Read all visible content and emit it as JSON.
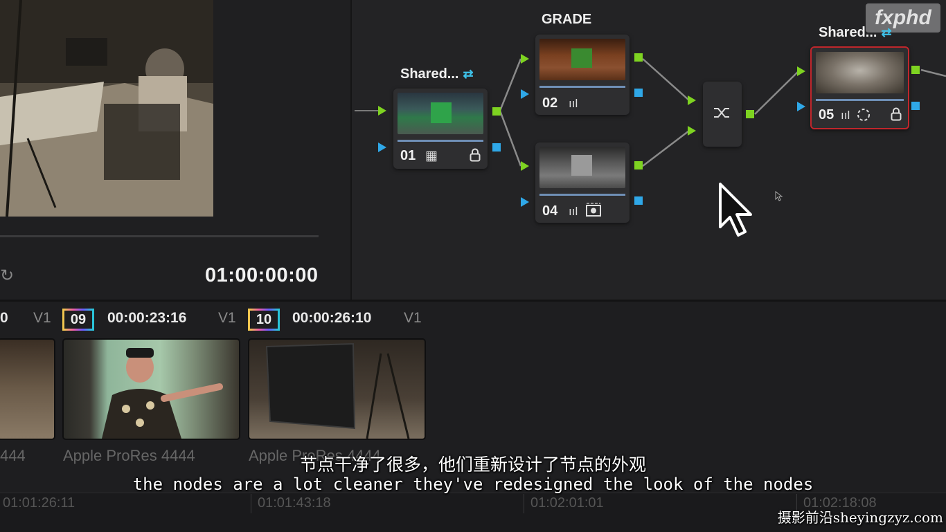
{
  "viewer": {
    "timecode": "01:00:00:00"
  },
  "watermark": "fxphd",
  "nodes": {
    "n01": {
      "label": "Shared...",
      "number": "01"
    },
    "n02": {
      "label": "GRADE",
      "number": "02"
    },
    "n04": {
      "number": "04"
    },
    "n05": {
      "label": "Shared...",
      "number": "05"
    }
  },
  "clips": [
    {
      "index": "0",
      "timecode": "",
      "track": "V1",
      "codec": "444"
    },
    {
      "index": "09",
      "timecode": "00:00:23:16",
      "track": "V1",
      "codec": "Apple ProRes 4444"
    },
    {
      "index": "10",
      "timecode": "00:00:26:10",
      "track": "V1",
      "codec": "Apple ProRes 4444"
    }
  ],
  "ruler": [
    "01:01:26:11",
    "01:01:43:18",
    "01:02:01:01",
    "01:02:18:08"
  ],
  "subtitles": {
    "chinese": "节点干净了很多，他们重新设计了节点的外观",
    "english": "the nodes are a lot cleaner they've redesigned the look of the nodes"
  },
  "site_mark": "摄影前沿sheyingzyz.com",
  "colors": {
    "port_green": "#7ed321",
    "port_blue": "#2fa8e8",
    "selected_node_border": "#c0262c"
  },
  "icons": [
    "sync-icon",
    "grid-icon",
    "lock-icon",
    "bars-icon",
    "mask-icon",
    "circle-dashed-icon",
    "mixer-icon",
    "shared-arrows-icon",
    "pointer-cursor-icon"
  ]
}
